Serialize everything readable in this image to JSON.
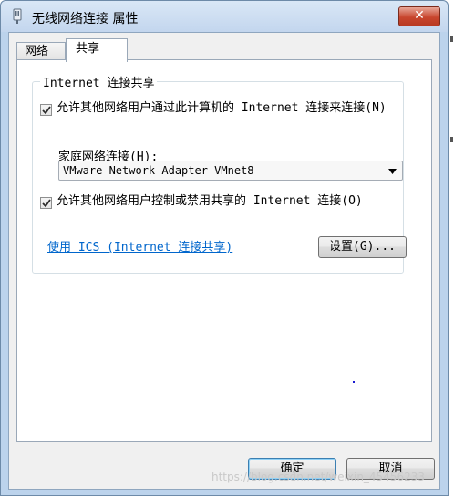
{
  "window": {
    "title": "无线网络连接 属性",
    "close_label": "✕"
  },
  "tabs": [
    {
      "label": "网络",
      "active": false
    },
    {
      "label": "共享",
      "active": true
    }
  ],
  "sharing": {
    "group_title": "Internet 连接共享",
    "allow_connect": {
      "label": "允许其他网络用户通过此计算机的 Internet 连接来连接(N)",
      "checked": true
    },
    "home_network_label": "家庭网络连接(H):",
    "home_network_value": "VMware Network Adapter VMnet8",
    "allow_control": {
      "label": "允许其他网络用户控制或禁用共享的 Internet 连接(O)",
      "checked": true
    },
    "ics_link": "使用 ICS (Internet 连接共享)",
    "settings_button": "设置(G)..."
  },
  "footer": {
    "ok_button": "确定",
    "cancel_button": "取消"
  },
  "watermark": "https://blog.csdn.net/weixin_45456233",
  "colors": {
    "link": "#0066cc",
    "close_button": "#c8462e",
    "titlebar": "#c3d6ee"
  },
  "icons": {
    "title": "network-adapter-icon",
    "check": "check-mark-icon",
    "dropdown": "chevron-down-icon"
  }
}
